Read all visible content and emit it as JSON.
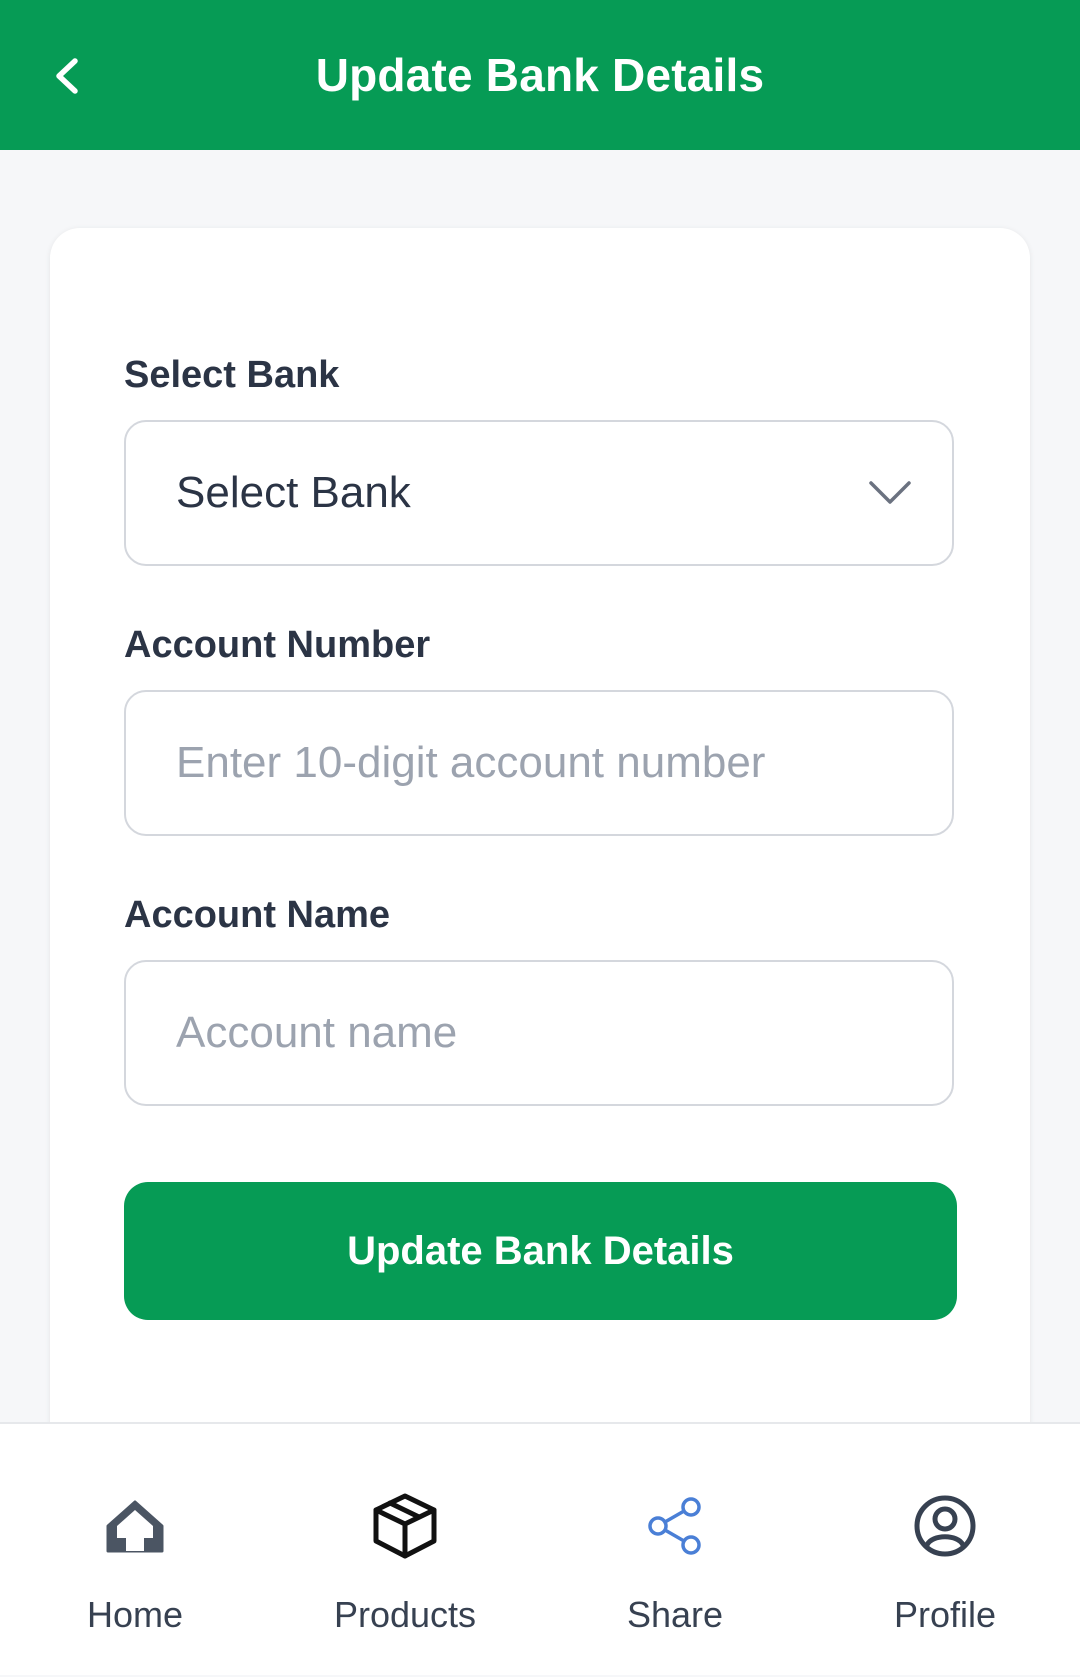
{
  "header": {
    "title": "Update Bank Details"
  },
  "form": {
    "bank": {
      "label": "Select Bank",
      "selected": "Select Bank"
    },
    "account_number": {
      "label": "Account Number",
      "placeholder": "Enter 10-digit account number"
    },
    "account_name": {
      "label": "Account Name",
      "placeholder": "Account name"
    },
    "submit_label": "Update Bank Details"
  },
  "nav": {
    "items": [
      {
        "label": "Home",
        "icon": "home-icon"
      },
      {
        "label": "Products",
        "icon": "box-icon"
      },
      {
        "label": "Share",
        "icon": "share-icon"
      },
      {
        "label": "Profile",
        "icon": "user-circle-icon"
      }
    ]
  },
  "colors": {
    "brand": "#069b55",
    "share_icon": "#4a7fd6"
  }
}
